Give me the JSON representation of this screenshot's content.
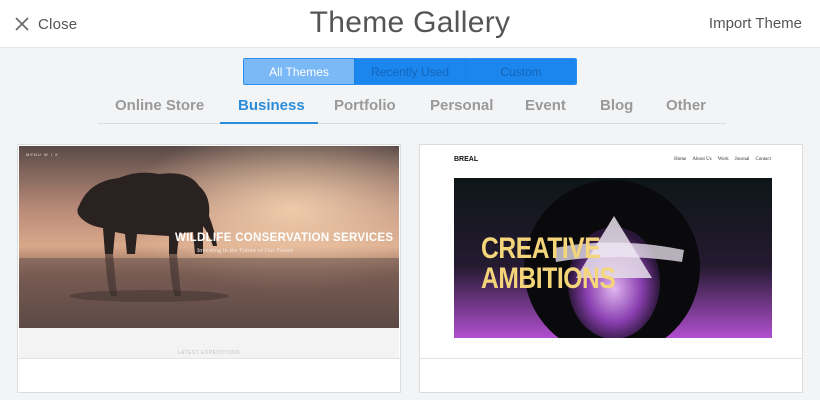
{
  "header": {
    "close_label": "Close",
    "title": "Theme Gallery",
    "import_label": "Import Theme"
  },
  "segments": [
    {
      "label": "All Themes",
      "active": true
    },
    {
      "label": "Recently Used",
      "active": false
    },
    {
      "label": "Custom",
      "active": false
    }
  ],
  "categories": [
    {
      "label": "Online Store",
      "active": false
    },
    {
      "label": "Business",
      "active": true
    },
    {
      "label": "Portfolio",
      "active": false
    },
    {
      "label": "Personal",
      "active": false
    },
    {
      "label": "Event",
      "active": false
    },
    {
      "label": "Blog",
      "active": false
    },
    {
      "label": "Other",
      "active": false
    }
  ],
  "themes": [
    {
      "nav": "MENU   W I X",
      "title": "WILDLIFE CONSERVATION SERVICES",
      "subtitle": "Investing in the Future of Our Planet",
      "footer_text": "LATEST EXPEDITIONS"
    },
    {
      "logo": "BREAL",
      "nav": [
        "Home",
        "About Us",
        "Work",
        "Journal",
        "Contact"
      ],
      "headline_1": "CREATIVE",
      "headline_2": "AMBITIONS"
    }
  ],
  "colors": {
    "accent": "#2b8cd9",
    "segment_active": "#7ab9f5",
    "segment_inactive": "#1a86ee",
    "category_inactive": "#9a9a9a"
  }
}
